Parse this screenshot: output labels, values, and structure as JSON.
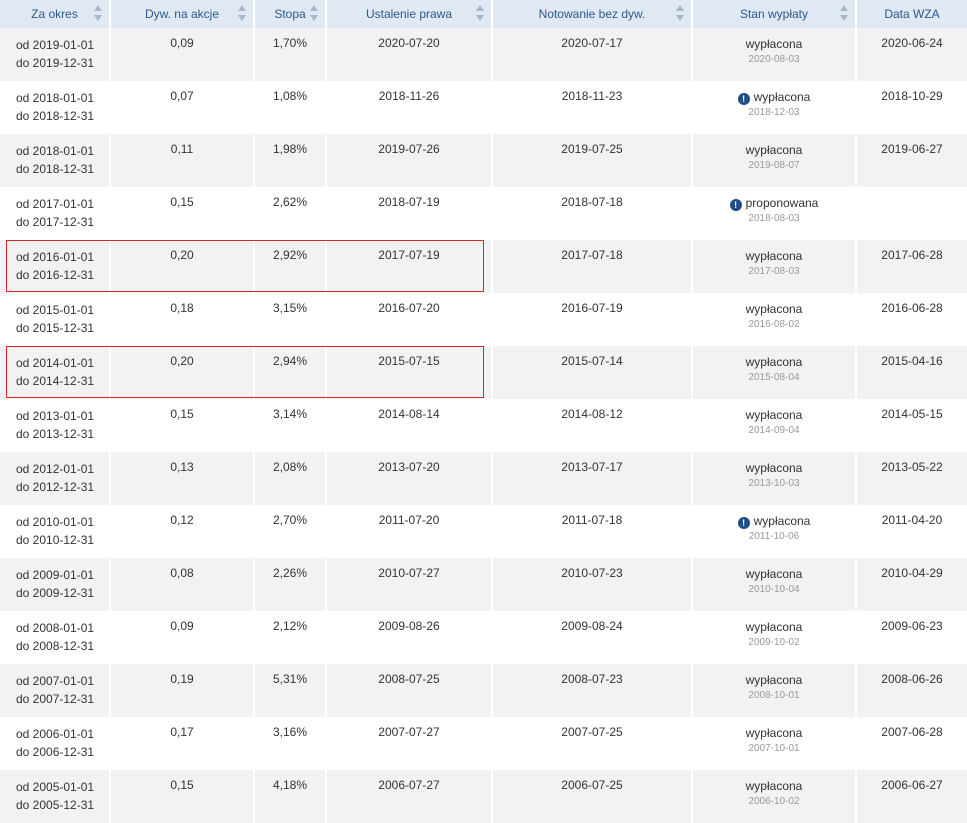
{
  "headers": [
    "Za okres",
    "Dyw. na akcje",
    "Stopa",
    "Ustalenie prawa",
    "Notowanie bez dyw.",
    "Stan wypłaty",
    "Data WZA"
  ],
  "rows": [
    {
      "from": "od 2019-01-01",
      "to": "do 2019-12-31",
      "dividend": "0,09",
      "rate": "1,70%",
      "record": "2020-07-20",
      "exdiv": "2020-07-17",
      "status": "wypłacona",
      "status_date": "2020-08-03",
      "info": false,
      "agm": "2020-06-24"
    },
    {
      "from": "od 2018-01-01",
      "to": "do 2018-12-31",
      "dividend": "0,07",
      "rate": "1,08%",
      "record": "2018-11-26",
      "exdiv": "2018-11-23",
      "status": "wypłacona",
      "status_date": "2018-12-03",
      "info": true,
      "agm": "2018-10-29"
    },
    {
      "from": "od 2018-01-01",
      "to": "do 2018-12-31",
      "dividend": "0,11",
      "rate": "1,98%",
      "record": "2019-07-26",
      "exdiv": "2019-07-25",
      "status": "wypłacona",
      "status_date": "2019-08-07",
      "info": false,
      "agm": "2019-06-27"
    },
    {
      "from": "od 2017-01-01",
      "to": "do 2017-12-31",
      "dividend": "0,15",
      "rate": "2,62%",
      "record": "2018-07-19",
      "exdiv": "2018-07-18",
      "status": "proponowana",
      "status_date": "2018-08-03",
      "info": true,
      "agm": ""
    },
    {
      "from": "od 2016-01-01",
      "to": "do 2016-12-31",
      "dividend": "0,20",
      "rate": "2,92%",
      "record": "2017-07-19",
      "exdiv": "2017-07-18",
      "status": "wypłacona",
      "status_date": "2017-08-03",
      "info": false,
      "agm": "2017-06-28"
    },
    {
      "from": "od 2015-01-01",
      "to": "do 2015-12-31",
      "dividend": "0,18",
      "rate": "3,15%",
      "record": "2016-07-20",
      "exdiv": "2016-07-19",
      "status": "wypłacona",
      "status_date": "2016-08-02",
      "info": false,
      "agm": "2016-06-28"
    },
    {
      "from": "od 2014-01-01",
      "to": "do 2014-12-31",
      "dividend": "0,20",
      "rate": "2,94%",
      "record": "2015-07-15",
      "exdiv": "2015-07-14",
      "status": "wypłacona",
      "status_date": "2015-08-04",
      "info": false,
      "agm": "2015-04-16"
    },
    {
      "from": "od 2013-01-01",
      "to": "do 2013-12-31",
      "dividend": "0,15",
      "rate": "3,14%",
      "record": "2014-08-14",
      "exdiv": "2014-08-12",
      "status": "wypłacona",
      "status_date": "2014-09-04",
      "info": false,
      "agm": "2014-05-15"
    },
    {
      "from": "od 2012-01-01",
      "to": "do 2012-12-31",
      "dividend": "0,13",
      "rate": "2,08%",
      "record": "2013-07-20",
      "exdiv": "2013-07-17",
      "status": "wypłacona",
      "status_date": "2013-10-03",
      "info": false,
      "agm": "2013-05-22"
    },
    {
      "from": "od 2010-01-01",
      "to": "do 2010-12-31",
      "dividend": "0,12",
      "rate": "2,70%",
      "record": "2011-07-20",
      "exdiv": "2011-07-18",
      "status": "wypłacona",
      "status_date": "2011-10-06",
      "info": true,
      "agm": "2011-04-20"
    },
    {
      "from": "od 2009-01-01",
      "to": "do 2009-12-31",
      "dividend": "0,08",
      "rate": "2,26%",
      "record": "2010-07-27",
      "exdiv": "2010-07-23",
      "status": "wypłacona",
      "status_date": "2010-10-04",
      "info": false,
      "agm": "2010-04-29"
    },
    {
      "from": "od 2008-01-01",
      "to": "do 2008-12-31",
      "dividend": "0,09",
      "rate": "2,12%",
      "record": "2009-08-26",
      "exdiv": "2009-08-24",
      "status": "wypłacona",
      "status_date": "2009-10-02",
      "info": false,
      "agm": "2009-06-23"
    },
    {
      "from": "od 2007-01-01",
      "to": "do 2007-12-31",
      "dividend": "0,19",
      "rate": "5,31%",
      "record": "2008-07-25",
      "exdiv": "2008-07-23",
      "status": "wypłacona",
      "status_date": "2008-10-01",
      "info": false,
      "agm": "2008-06-26"
    },
    {
      "from": "od 2006-01-01",
      "to": "do 2006-12-31",
      "dividend": "0,17",
      "rate": "3,16%",
      "record": "2007-07-27",
      "exdiv": "2007-07-25",
      "status": "wypłacona",
      "status_date": "2007-10-01",
      "info": false,
      "agm": "2007-06-28"
    },
    {
      "from": "od 2005-01-01",
      "to": "do 2005-12-31",
      "dividend": "0,15",
      "rate": "4,18%",
      "record": "2006-07-27",
      "exdiv": "2006-07-25",
      "status": "wypłacona",
      "status_date": "2006-10-02",
      "info": false,
      "agm": "2006-06-27"
    }
  ],
  "highlighted_rows": [
    4,
    6
  ],
  "colors": {
    "header_bg": "#dfe8f3",
    "header_text": "#2b5a8c",
    "highlight_border": "#d9262a",
    "info_icon": "#1f4e89"
  },
  "icons": {
    "info": "info-circle-icon",
    "sort": "sort-arrows-icon"
  }
}
